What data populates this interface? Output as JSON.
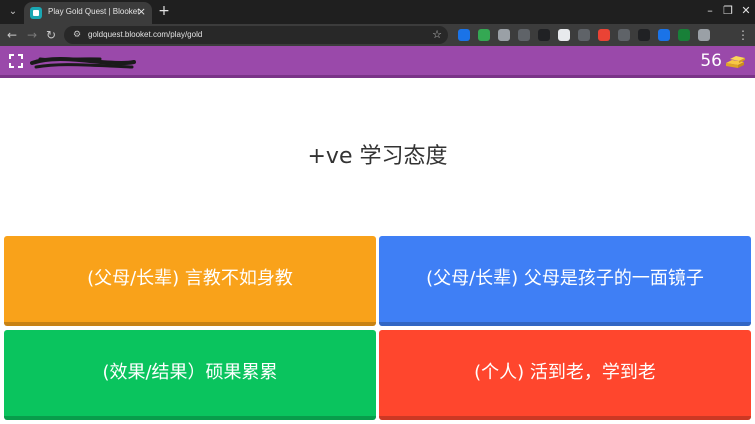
{
  "browser": {
    "tab": {
      "title": "Play Gold Quest | Blooket",
      "favicon": "blooket-favicon",
      "close_glyph": "×"
    },
    "new_tab_glyph": "+",
    "tab_search_glyph": "⌄",
    "window_controls": {
      "minimize": "–",
      "restore": "❐",
      "close": "✕"
    },
    "nav": {
      "back": "←",
      "forward": "→",
      "reload": "↻"
    },
    "address": {
      "url": "goldquest.blooket.com/play/gold",
      "site_info_glyph": "⚙",
      "bookmark_glyph": "☆"
    },
    "menu_glyph": "⋮",
    "extension_colors": [
      "#1a73e8",
      "#34a853",
      "#9aa0a6",
      "#5f6368",
      "#202124",
      "#e8eaed",
      "#5f6368",
      "#ea4335",
      "#5f6368",
      "#202124",
      "#1a73e8",
      "#188038",
      "#9aa0a6"
    ]
  },
  "game": {
    "header": {
      "color": "#9a49aa",
      "player_name": "",
      "gold": "56",
      "gold_icon": "gold-bars-icon",
      "fullscreen_icon": "fullscreen-icon"
    },
    "question": "+ve 学习态度",
    "answers": [
      {
        "text": "(父母/长辈) 言教不如身教",
        "color": "#f9a21a"
      },
      {
        "text": "(父母/长辈) 父母是孩子的一面镜子",
        "color": "#3f7ff5"
      },
      {
        "text": "(效果/结果）硕果累累",
        "color": "#0ac45e"
      },
      {
        "text": "(个人) 活到老，学到老",
        "color": "#ff462d"
      }
    ]
  }
}
